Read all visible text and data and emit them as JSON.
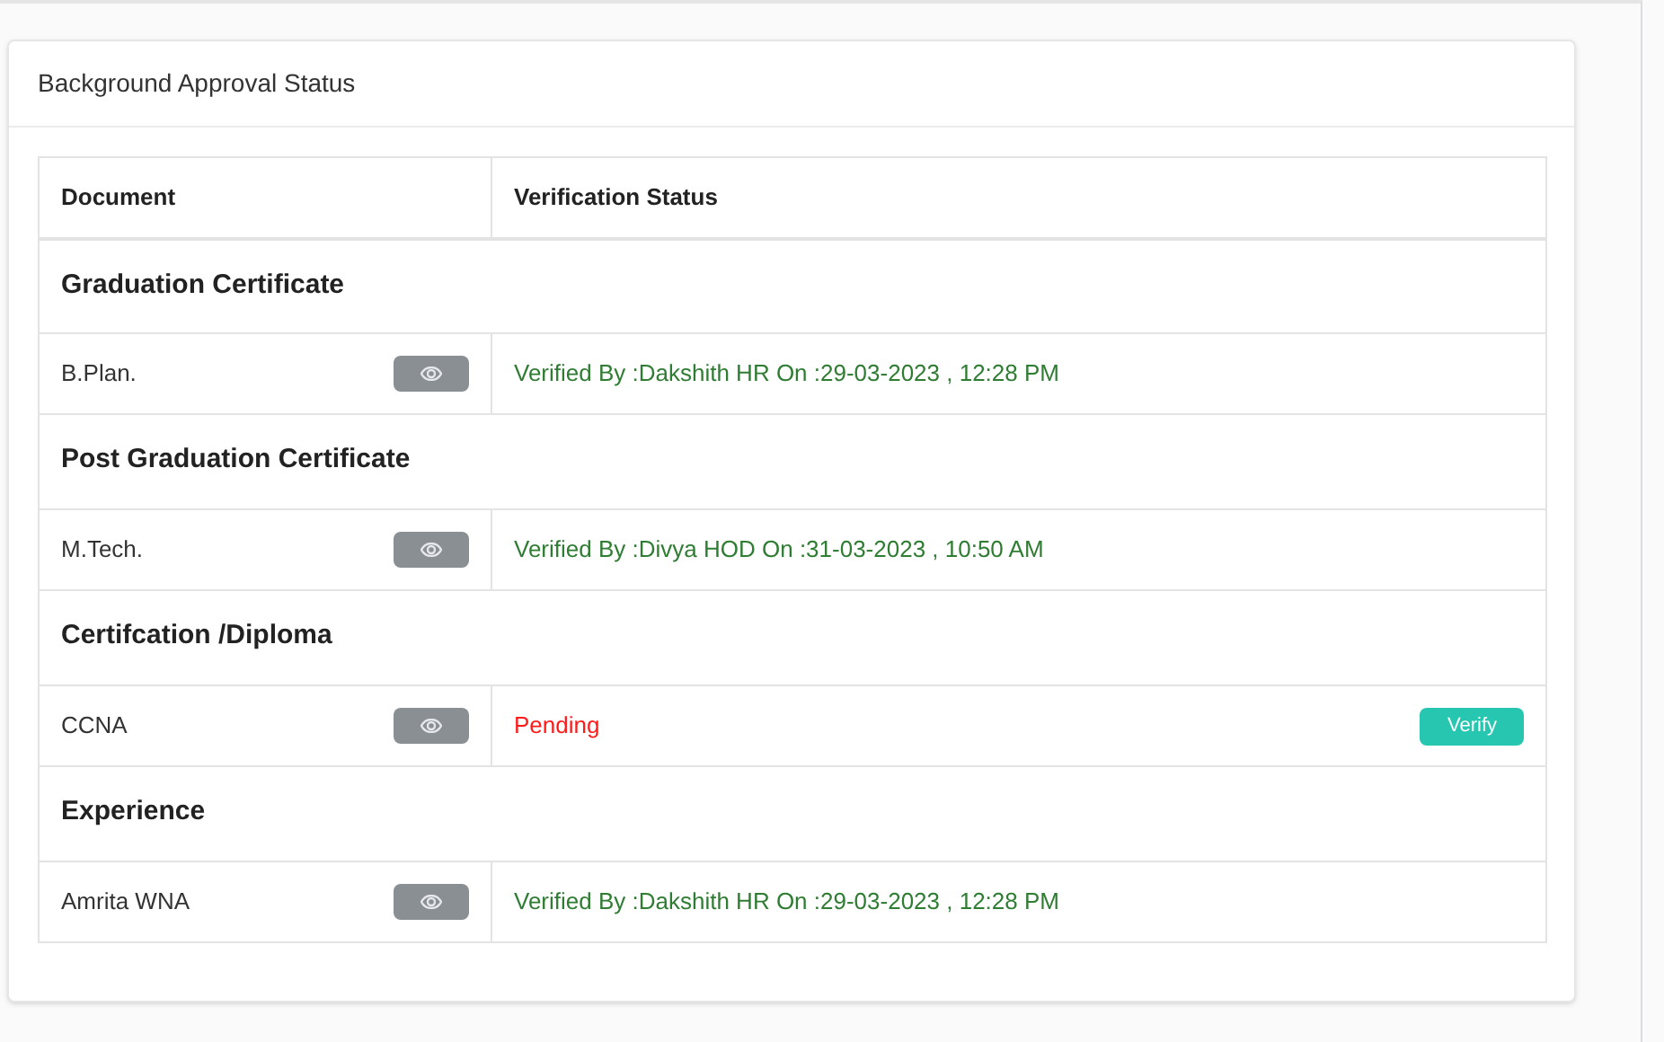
{
  "card": {
    "title": "Background Approval Status"
  },
  "table": {
    "columns": [
      "Document",
      "Verification Status"
    ],
    "groups": [
      {
        "title": "Graduation Certificate",
        "items": [
          {
            "document": "B.Plan.",
            "kind": "verified",
            "status": "Verified By :Dakshith HR On :29-03-2023 , 12:28 PM"
          }
        ]
      },
      {
        "title": "Post Graduation Certificate",
        "items": [
          {
            "document": "M.Tech.",
            "kind": "verified",
            "status": "Verified By :Divya HOD On :31-03-2023 , 10:50 AM"
          }
        ]
      },
      {
        "title": "Certifcation /Diploma",
        "items": [
          {
            "document": "CCNA",
            "kind": "pending",
            "status": "Pending",
            "action": "Verify"
          }
        ]
      },
      {
        "title": "Experience",
        "items": [
          {
            "document": "Amrita WNA",
            "kind": "verified",
            "status": "Verified By :Dakshith HR On :29-03-2023 , 12:28 PM"
          }
        ]
      }
    ]
  }
}
